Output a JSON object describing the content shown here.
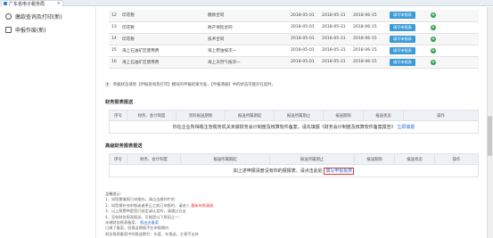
{
  "browser": {
    "tab_title": "广东省电子税务局"
  },
  "sidebar": {
    "items": [
      {
        "label": "缴款查询及打印(新)",
        "icon": "circle-icon"
      },
      {
        "label": "申报作废(新)",
        "icon": "document-icon"
      }
    ]
  },
  "top_table": {
    "rows": [
      {
        "no": "12",
        "name": "印花税",
        "item": "缴款合同",
        "start": "2018-05-01",
        "end": "2018-05-31",
        "deadline": "2018-06-15",
        "action": "填写申报表"
      },
      {
        "no": "13",
        "name": "印花税",
        "item": "财产保险合同",
        "start": "2018-05-01",
        "end": "2018-05-31",
        "deadline": "2018-06-15",
        "action": "填写申报表"
      },
      {
        "no": "14",
        "name": "印花税",
        "item": "技术合同",
        "start": "2018-05-01",
        "end": "2018-05-31",
        "deadline": "2018-06-15",
        "action": "填写申报表"
      },
      {
        "no": "15",
        "name": "海上石油矿区使用费",
        "item": "海上原油按次一",
        "start": "2018-05-01",
        "end": "2018-05-31",
        "deadline": "2018-06-15",
        "action": "填写申报表"
      },
      {
        "no": "16",
        "name": "海上石油矿区使用费",
        "item": "海上天然气按次一",
        "start": "2018-05-01",
        "end": "2018-05-31",
        "deadline": "2018-06-15",
        "action": "填写申报表"
      }
    ]
  },
  "note": "注：单据状态请到【申报查询及打印】模块的申报结果为准，【申报清册】中的状态可能存在延时。",
  "financial_section": {
    "title": "财务报表报送",
    "headers": [
      "序号",
      "财务、会计制度",
      "资料报送期限",
      "报送所属期起",
      "报送所属期止",
      "报送期限",
      "报送状态",
      "操作"
    ],
    "message": "你在企业所得税主管税务机关未做财务会计制度及核算软件备案，请先填报《财务会计制度及核算软件备案报告》",
    "message_link": "立即填报"
  },
  "advanced_section": {
    "title": "高级财务报表报送",
    "headers": [
      "序号",
      "财务、会计制度",
      "报送所属期起",
      "报送所属期止",
      "报送期限",
      "报送状态",
      "操作"
    ],
    "message": "如上述申报清册没有你的报报表，请点击此处",
    "message_link": "填写申报报表"
  },
  "tips": {
    "title": "温馨提示：",
    "lines": [
      "1、如您需填报已申报的，请点击操作栏的",
      "2、如您需补充申报或者更正之前已申报的，请进入",
      "3、以上税费种是您已核定或认定的，请通过点击",
      "4、没有财务报表报送，可能是以下原因之一：",
      "    未做财务报表备案，",
      "    已做了备案，但报送期限不在申报期内",
      "    财务报表备案中的报送期为：年度、年报送，主表不支持"
    ],
    "highlight": "重新申报清册",
    "link": "报出去备案"
  }
}
